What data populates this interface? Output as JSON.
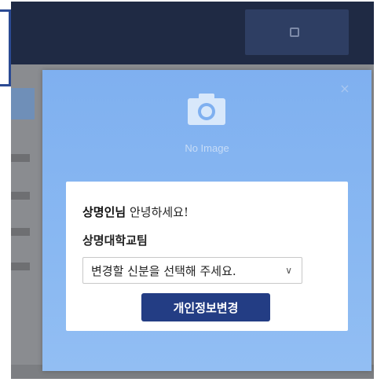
{
  "background": {
    "header_button_label": "",
    "colors": {
      "header": "#1f2a44",
      "overlay": "#8a8c90"
    }
  },
  "modal": {
    "close_icon": "close-icon",
    "avatar": {
      "icon": "camera-icon",
      "caption": "No Image"
    },
    "greeting": {
      "name": "상명인님",
      "message": " 안녕하세요!"
    },
    "affiliation": "상명대학교팀",
    "role_select": {
      "selected": "변경할 신분을 선택해 주세요.",
      "chevron": "chevron-down-icon"
    },
    "submit_label": "개인정보변경",
    "colors": {
      "modal_bg": "#89b8f2",
      "button": "#233d84"
    }
  }
}
